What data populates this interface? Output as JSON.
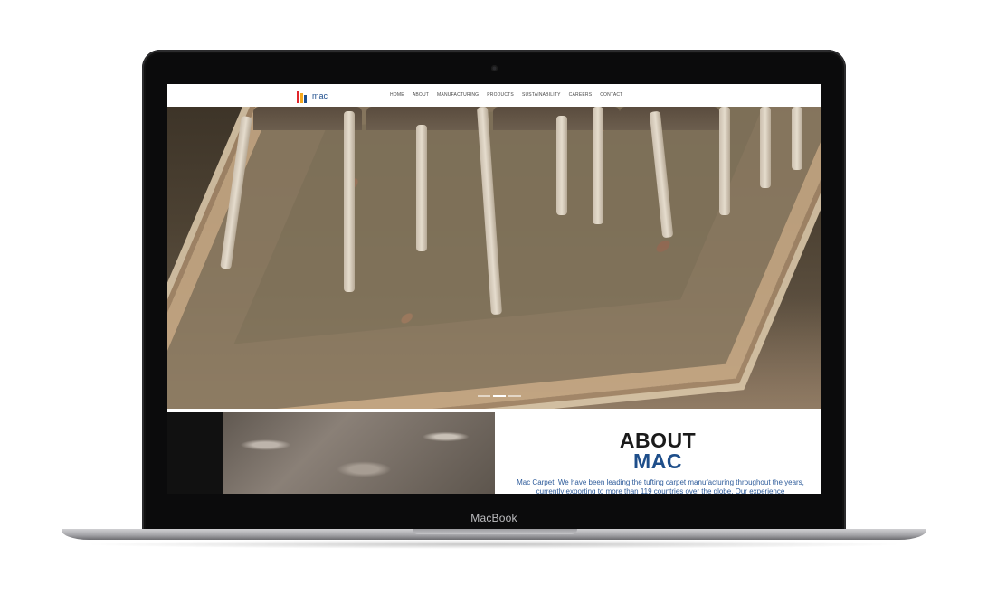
{
  "device": {
    "label": "MacBook"
  },
  "site": {
    "logo": {
      "text": "mac",
      "icon": "mac-logo-icon",
      "colors": [
        "#e0262c",
        "#f4a81d",
        "#1d4d8c"
      ]
    },
    "nav": {
      "items": [
        {
          "label": "HOME"
        },
        {
          "label": "ABOUT"
        },
        {
          "label": "MANUFACTURING"
        },
        {
          "label": "PRODUCTS"
        },
        {
          "label": "SUSTAINABILITY"
        },
        {
          "label": "CAREERS"
        },
        {
          "label": "CONTACT"
        }
      ]
    },
    "hero": {
      "slide_active": 2,
      "slide_count": 3
    },
    "about": {
      "title_line1": "ABOUT",
      "title_line2": "MAC",
      "text": "Mac Carpet. We have been leading the tufting carpet manufacturing throughout the years, currently exporting to more than 119 countries over the globe. Our experience",
      "title_color": "#1a1a1a",
      "accent_color": "#1e4e8a"
    }
  }
}
